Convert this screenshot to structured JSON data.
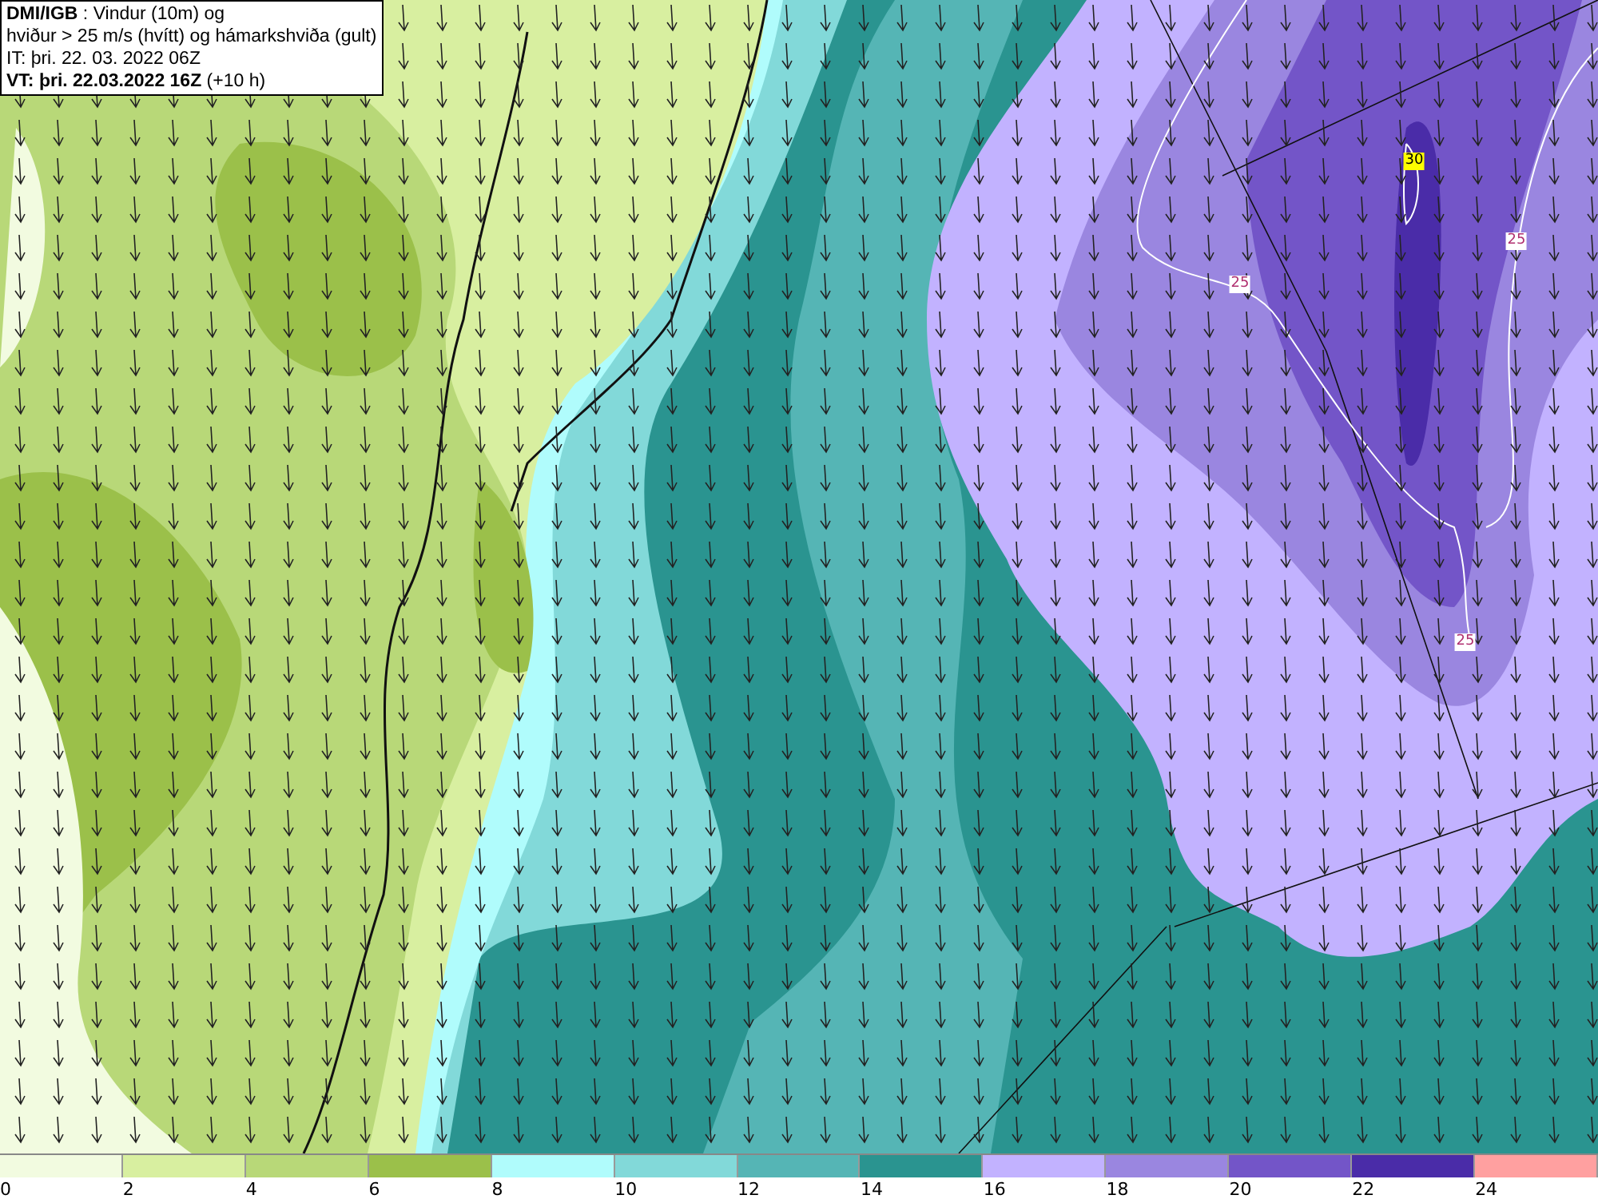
{
  "title_box": {
    "lines": [
      "**DMI/IGB** : Vindur (10m) og",
      "hviður > 25 m/s (hvítt) og hámarkshviða (gult)",
      "IT: þri. 22. 03. 2022 06Z",
      "**VT: þri. 22.03.2022 16Z** (+10 h)"
    ]
  },
  "contour_labels": [
    {
      "text": "30",
      "kind": "max"
    },
    {
      "text": "25",
      "kind": "gust"
    },
    {
      "text": "25",
      "kind": "gust"
    },
    {
      "text": "25",
      "kind": "gust"
    }
  ],
  "legend": {
    "bins": [
      {
        "color": "#f2fbe0"
      },
      {
        "color": "#d8efa0"
      },
      {
        "color": "#b8d878"
      },
      {
        "color": "#9bc04a"
      },
      {
        "color": "#b0fcfc"
      },
      {
        "color": "#82d9d9"
      },
      {
        "color": "#55b5b5"
      },
      {
        "color": "#2a9490"
      },
      {
        "color": "#c2b2ff"
      },
      {
        "color": "#9a86e0"
      },
      {
        "color": "#7355c8"
      },
      {
        "color": "#4a2ca8"
      },
      {
        "color": "#ffa0a0"
      }
    ],
    "ticks": [
      "0",
      "2",
      "4",
      "6",
      "8",
      "10",
      "12",
      "14",
      "16",
      "18",
      "20",
      "22",
      "24"
    ]
  }
}
